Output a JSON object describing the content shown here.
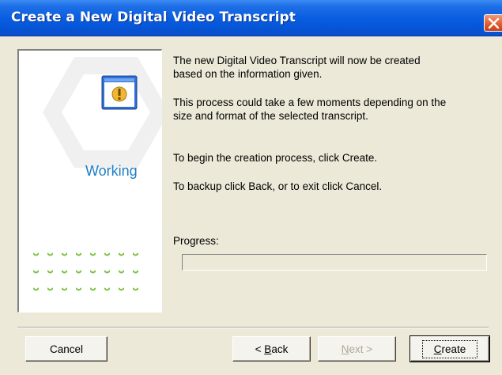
{
  "window": {
    "title": "Create a New Digital Video Transcript"
  },
  "side_panel": {
    "status": "Working",
    "icon": "app-window-warning-icon"
  },
  "messages": {
    "line1": "The new Digital Video Transcript will now be created",
    "line2": "based on the information given.",
    "line3": "This process could take a few moments depending on the",
    "line4": "size and format of the selected transcript.",
    "line5": "To begin the creation process, click Create.",
    "line6": "To backup click Back, or to exit click Cancel."
  },
  "progress": {
    "label": "Progress:",
    "value": 0
  },
  "buttons": {
    "cancel": "Cancel",
    "back_prefix": "< ",
    "back_mnemonic": "B",
    "back_rest": "ack",
    "next_mnemonic": "N",
    "next_rest": "ext >",
    "create_mnemonic": "C",
    "create_rest": "reate"
  },
  "colors": {
    "title_bar": "#0a5ee0",
    "working_text": "#1c7cc4",
    "dots": "#7cc243",
    "close_button": "#e05a2a"
  }
}
